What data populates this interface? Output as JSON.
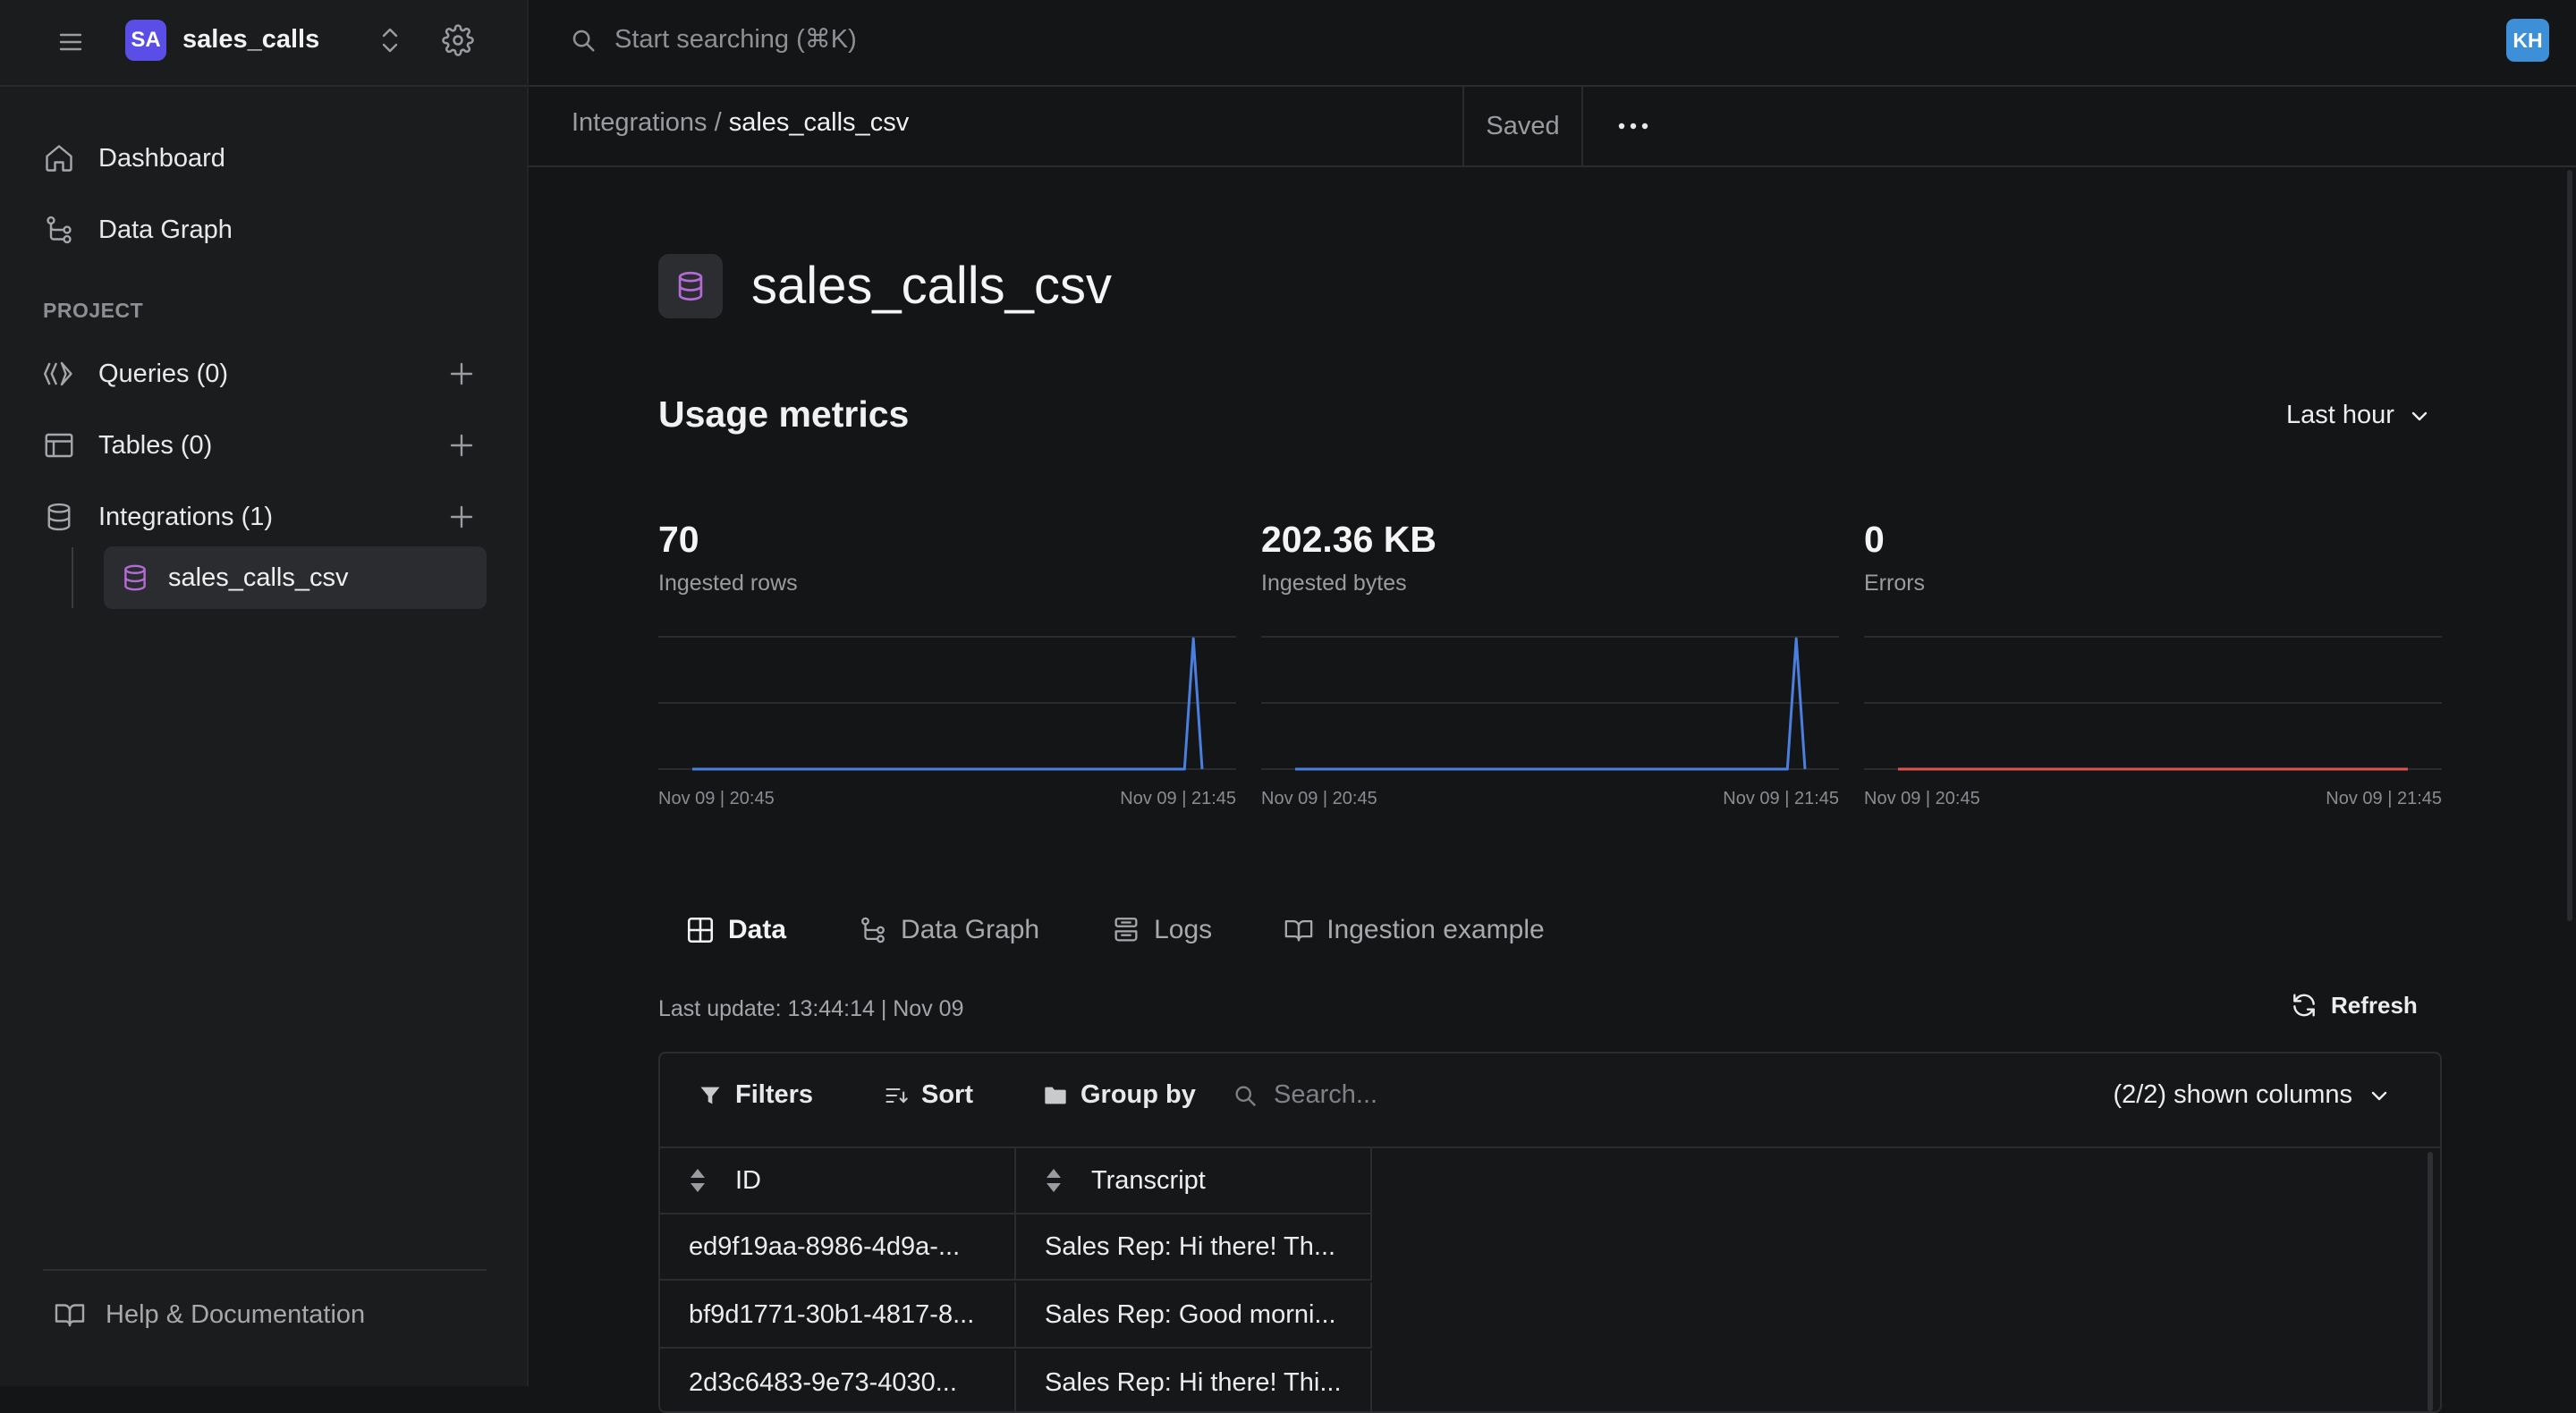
{
  "app": {
    "workspace_initials": "SA",
    "workspace_name": "sales_calls",
    "user_initials": "KH",
    "search_placeholder": "Start searching (⌘K)"
  },
  "sidebar": {
    "nav": [
      {
        "label": "Dashboard",
        "icon": "home-icon"
      },
      {
        "label": "Data Graph",
        "icon": "graph-icon"
      }
    ],
    "section_label": "PROJECT",
    "project_items": [
      {
        "label": "Queries (0)",
        "icon": "queries-icon"
      },
      {
        "label": "Tables (0)",
        "icon": "table-icon"
      },
      {
        "label": "Integrations (1)",
        "icon": "database-icon"
      }
    ],
    "active_child": "sales_calls_csv",
    "help": "Help & Documentation"
  },
  "breadcrumb": {
    "parent": "Integrations",
    "separator": " / ",
    "current": "sales_calls_csv",
    "status": "Saved"
  },
  "page": {
    "title": "sales_calls_csv",
    "metrics_title": "Usage metrics",
    "time_range": "Last hour"
  },
  "metrics": [
    {
      "value": "70",
      "label": "Ingested rows",
      "color": "#4a7fe0",
      "x_start": "Nov 09 | 20:45",
      "x_end": "Nov 09 | 21:45",
      "series": [
        0,
        0,
        0,
        0,
        0,
        0,
        0,
        0,
        0,
        0,
        0,
        0,
        0,
        0,
        0,
        0,
        0,
        0,
        0,
        0,
        0,
        0,
        0,
        0,
        0,
        0,
        0,
        0,
        0,
        0,
        0,
        0,
        0,
        0,
        0,
        0,
        0,
        0,
        0,
        0,
        0,
        0,
        0,
        0,
        0,
        0,
        0,
        0,
        0,
        0,
        0,
        0,
        0,
        0,
        0,
        0,
        0,
        70,
        0
      ]
    },
    {
      "value": "202.36 KB",
      "label": "Ingested bytes",
      "color": "#4a7fe0",
      "x_start": "Nov 09 | 20:45",
      "x_end": "Nov 09 | 21:45",
      "series": [
        0,
        0,
        0,
        0,
        0,
        0,
        0,
        0,
        0,
        0,
        0,
        0,
        0,
        0,
        0,
        0,
        0,
        0,
        0,
        0,
        0,
        0,
        0,
        0,
        0,
        0,
        0,
        0,
        0,
        0,
        0,
        0,
        0,
        0,
        0,
        0,
        0,
        0,
        0,
        0,
        0,
        0,
        0,
        0,
        0,
        0,
        0,
        0,
        0,
        0,
        0,
        0,
        0,
        0,
        0,
        0,
        0,
        202.36,
        0
      ]
    },
    {
      "value": "0",
      "label": "Errors",
      "color": "#e05252",
      "x_start": "Nov 09 | 20:45",
      "x_end": "Nov 09 | 21:45",
      "series": [
        0,
        0,
        0,
        0,
        0,
        0,
        0,
        0,
        0,
        0,
        0,
        0,
        0,
        0,
        0,
        0,
        0,
        0,
        0,
        0,
        0,
        0,
        0,
        0,
        0,
        0,
        0,
        0,
        0,
        0,
        0,
        0,
        0,
        0,
        0,
        0,
        0,
        0,
        0,
        0,
        0,
        0,
        0,
        0,
        0,
        0,
        0,
        0,
        0,
        0,
        0,
        0,
        0,
        0,
        0,
        0,
        0,
        0,
        0
      ]
    }
  ],
  "tabs": [
    {
      "label": "Data",
      "icon": "grid-icon",
      "active": true
    },
    {
      "label": "Data Graph",
      "icon": "graph-icon",
      "active": false
    },
    {
      "label": "Logs",
      "icon": "logs-icon",
      "active": false
    },
    {
      "label": "Ingestion example",
      "icon": "book-icon",
      "active": false
    }
  ],
  "data_view": {
    "last_update": "Last update: 13:44:14 | Nov 09",
    "refresh": "Refresh",
    "toolbar": {
      "filters": "Filters",
      "sort": "Sort",
      "group_by": "Group by",
      "search_placeholder": "Search...",
      "columns": "(2/2) shown columns"
    },
    "columns": [
      "ID",
      "Transcript"
    ],
    "rows": [
      [
        "ed9f19aa-8986-4d9a-...",
        "Sales Rep: Hi there! Th..."
      ],
      [
        "bf9d1771-30b1-4817-8...",
        "Sales Rep: Good morni..."
      ],
      [
        "2d3c6483-9e73-4030...",
        "Sales Rep: Hi there! Thi..."
      ]
    ]
  }
}
